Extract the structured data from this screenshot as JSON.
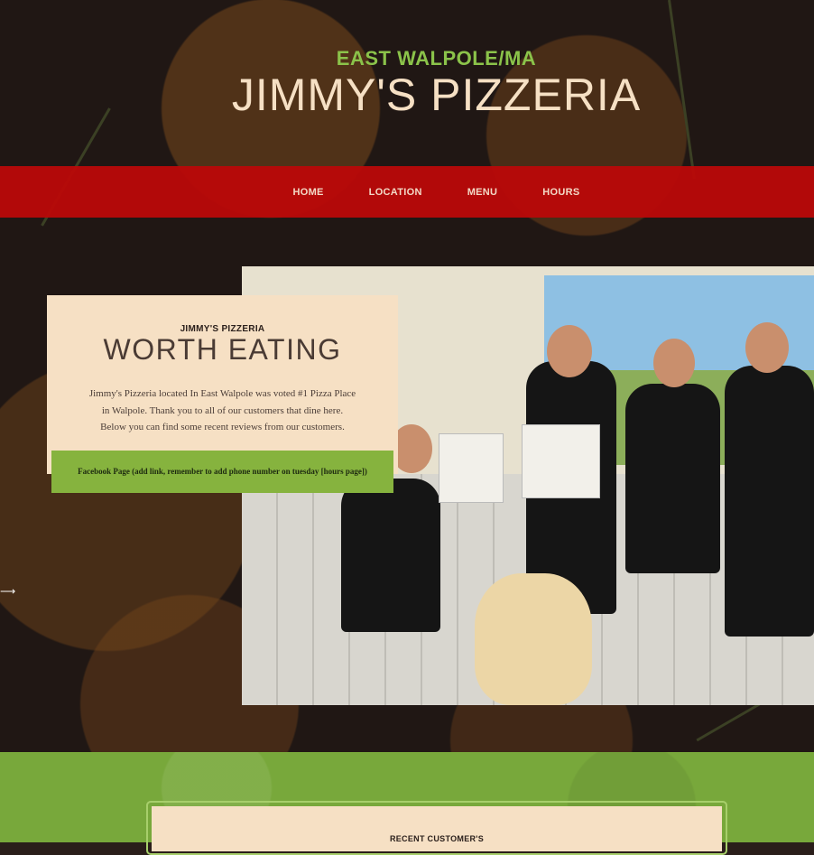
{
  "header": {
    "location": "EAST WALPOLE/MA",
    "title": "JIMMY'S PIZZERIA"
  },
  "nav": {
    "items": [
      {
        "label": "HOME"
      },
      {
        "label": "LOCATION"
      },
      {
        "label": "MENU"
      },
      {
        "label": "HOURS"
      }
    ]
  },
  "about": {
    "eyebrow": "JIMMY'S PIZZERIA",
    "heading": "WORTH EATING",
    "body_line1": "Jimmy's Pizzeria located In East Walpole was voted #1 Pizza Place",
    "body_line2": "in Walpole. Thank you to all of our customers that dine here.",
    "body_line3": "Below you can find some recent reviews from our customers.",
    "facebook_button": "Facebook Page (add link, remember to add phone number on tuesday [hours page])"
  },
  "reviews": {
    "label": "RECENT CUSTOMER'S"
  },
  "colors": {
    "accent_green": "#86b33e",
    "nav_red": "#ba0808",
    "cream": "#f6e0c4"
  },
  "icons": {
    "cursor": "cursor-icon"
  }
}
